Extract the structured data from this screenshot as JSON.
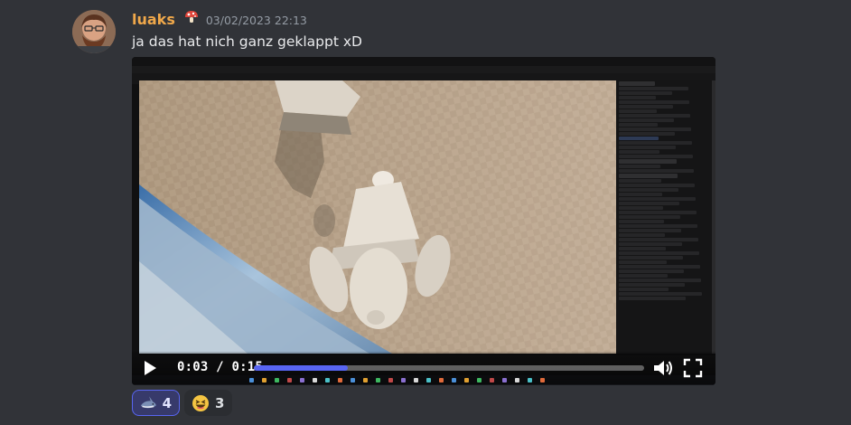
{
  "message": {
    "username": "luaks",
    "username_emoji": "mushroom-emoji",
    "timestamp": "03/02/2023 22:13",
    "text": "ja das hat nich ganz geklappt xD"
  },
  "video": {
    "current_time": "0:03",
    "separator": "/",
    "duration": "0:15",
    "progress_fraction": 0.24
  },
  "reactions": [
    {
      "emoji": "shark-emoji",
      "count": "4",
      "active": true
    },
    {
      "emoji": "laughing-emoji",
      "count": "3",
      "active": false
    }
  ],
  "colors": {
    "background": "#313338",
    "username": "#f0a84a",
    "timestamp": "#949ba4",
    "accent": "#5865f2"
  }
}
